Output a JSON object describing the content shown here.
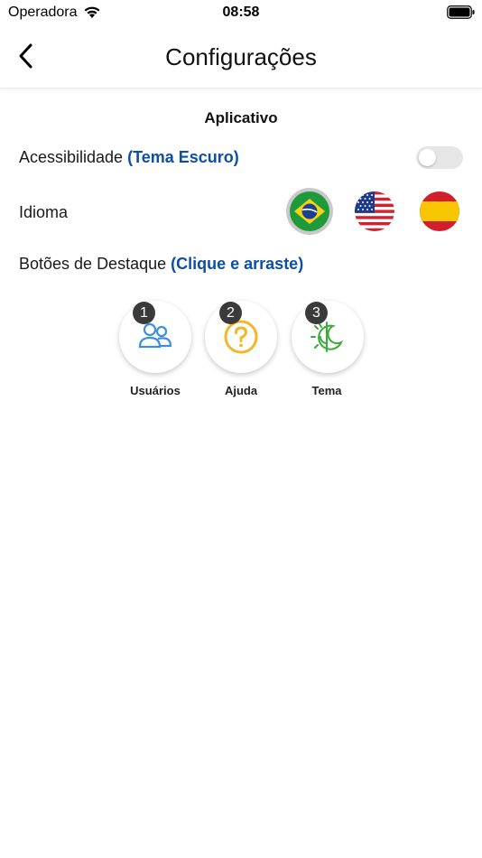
{
  "status_bar": {
    "carrier": "Operadora",
    "time": "08:58"
  },
  "nav": {
    "title": "Configurações"
  },
  "section": {
    "title": "Aplicativo"
  },
  "accessibility": {
    "label": "Acessibilidade",
    "hint": "(Tema Escuro)",
    "enabled": false
  },
  "language": {
    "label": "Idioma",
    "options": [
      {
        "icon": "brazil-flag-icon",
        "selected": true
      },
      {
        "icon": "usa-flag-icon",
        "selected": false
      },
      {
        "icon": "spain-flag-icon",
        "selected": false
      }
    ]
  },
  "highlight": {
    "label": "Botões de Destaque",
    "hint": "(Clique e arraste)",
    "buttons": [
      {
        "order": "1",
        "label": "Usuários",
        "icon": "users-icon",
        "color": "#3d8fe0"
      },
      {
        "order": "2",
        "label": "Ajuda",
        "icon": "help-icon",
        "color": "#f1b62a"
      },
      {
        "order": "3",
        "label": "Tema",
        "icon": "theme-icon",
        "color": "#3aaa3a"
      }
    ]
  },
  "colors": {
    "hint": "#0d4fa8",
    "badge": "#3a3a3a",
    "toggle_off": "#e6e6e6"
  }
}
